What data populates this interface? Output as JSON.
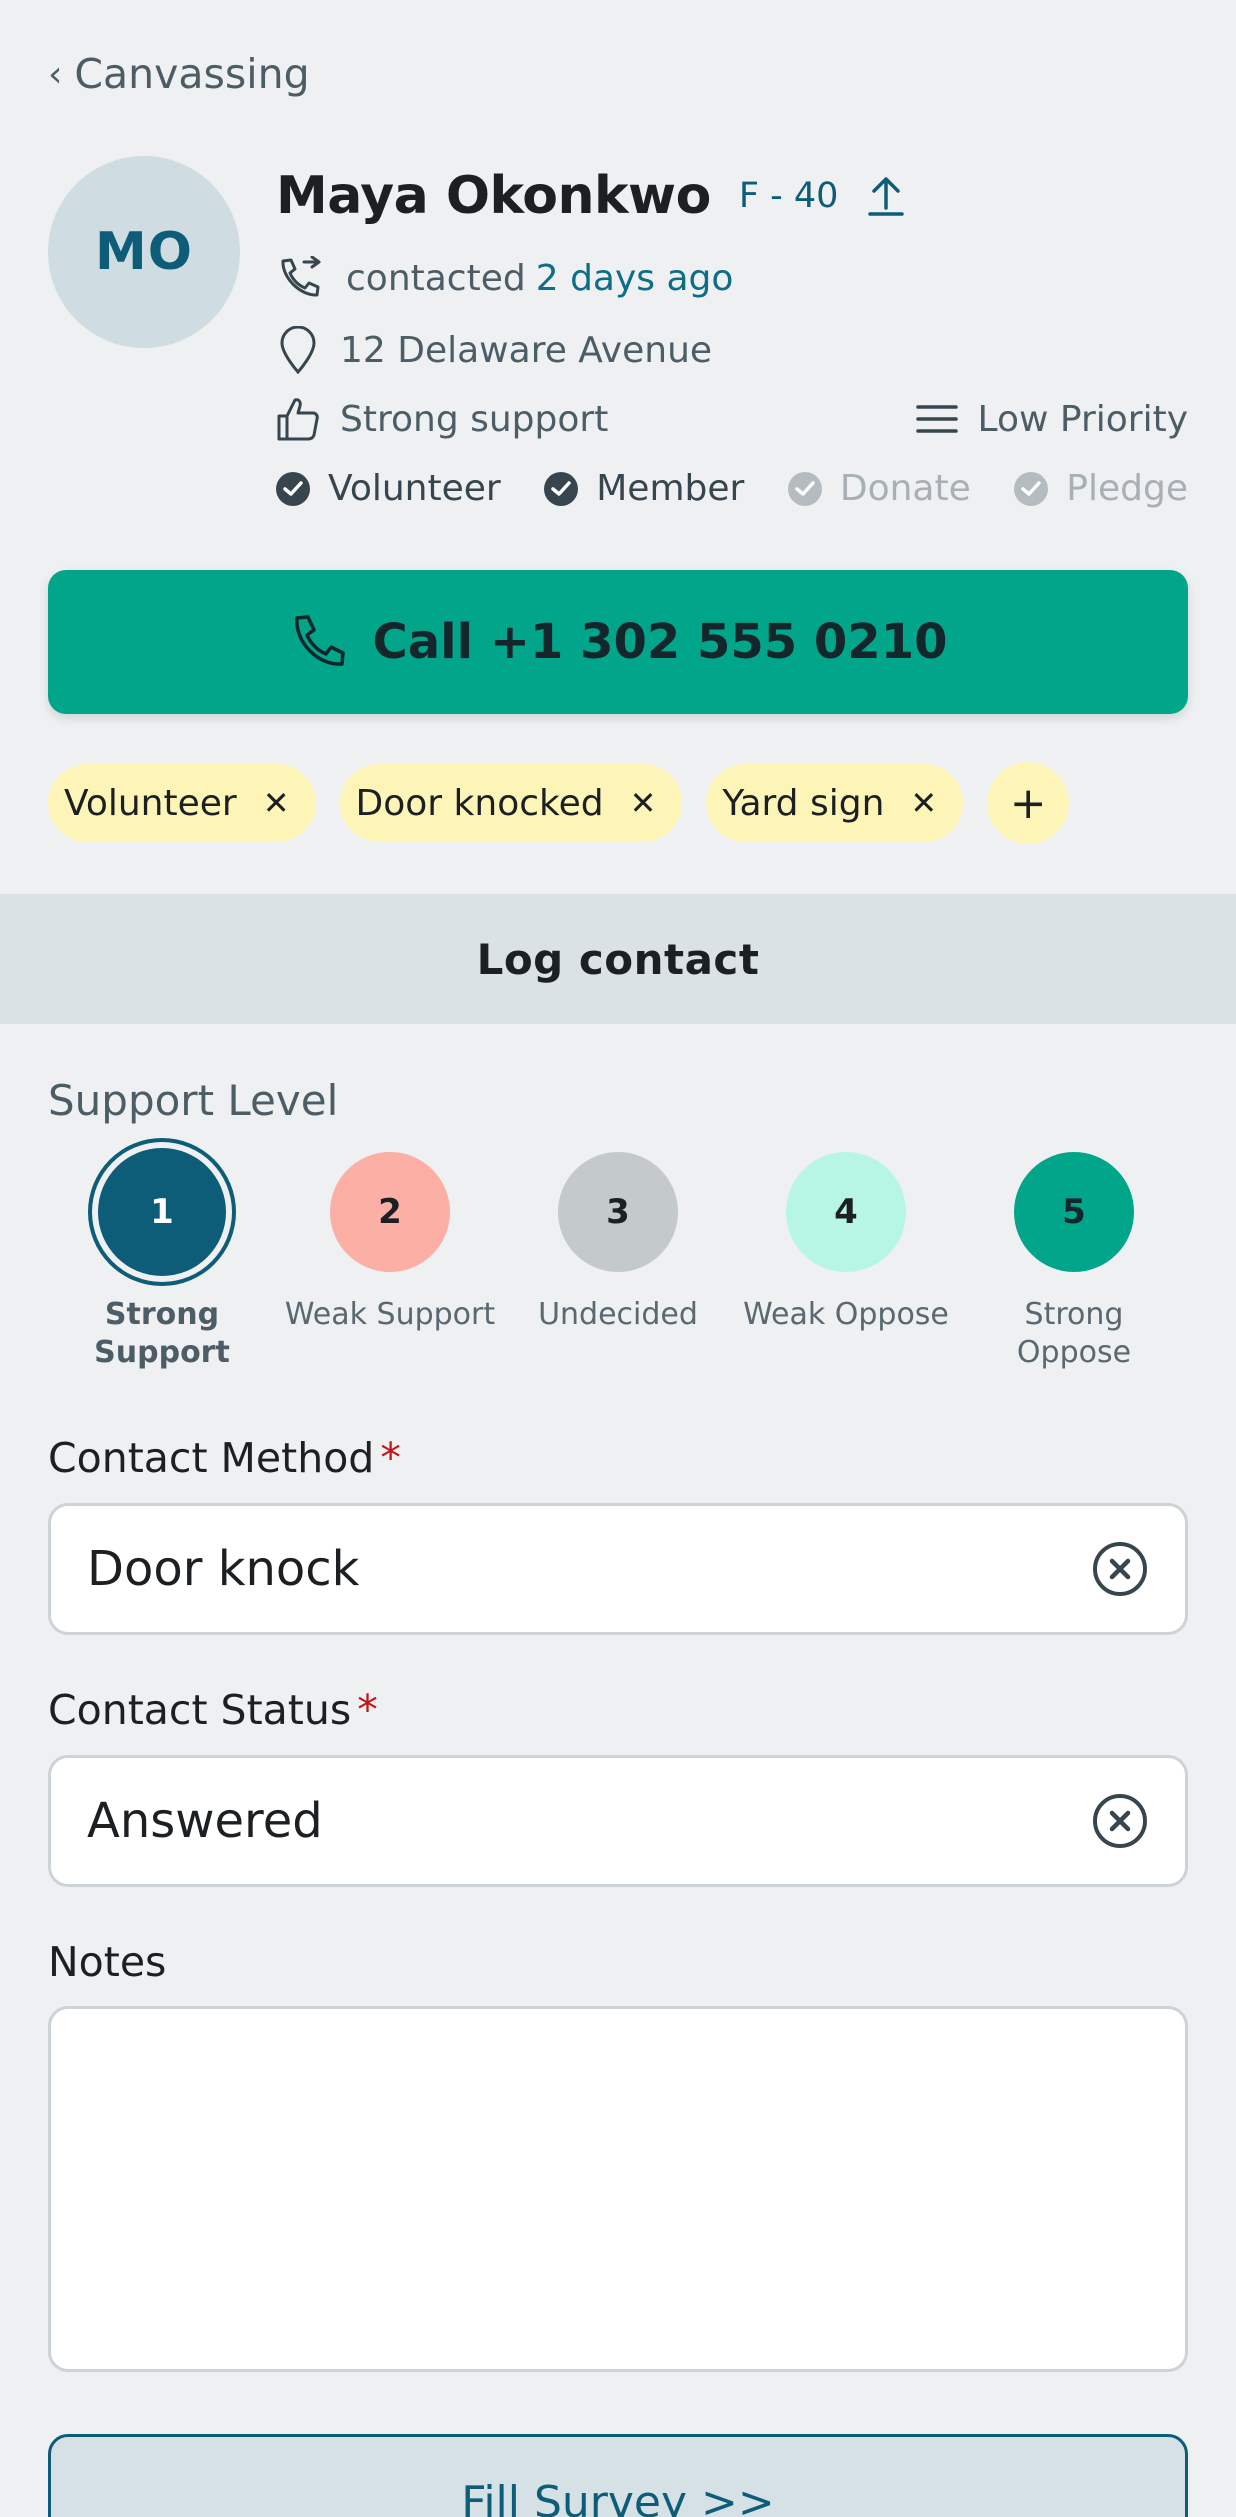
{
  "nav": {
    "back_label": "Canvassing"
  },
  "contact": {
    "initials": "MO",
    "name": "Maya Okonkwo",
    "gender_age": "F - 40",
    "contacted_prefix": "contacted",
    "contacted_when": "2 days ago",
    "address": "12 Delaware Avenue",
    "support": "Strong support",
    "priority": "Low Priority",
    "flags": [
      {
        "label": "Volunteer",
        "checked": true
      },
      {
        "label": "Member",
        "checked": true
      },
      {
        "label": "Donate",
        "checked": false
      },
      {
        "label": "Pledge",
        "checked": false
      }
    ]
  },
  "call_button": {
    "label": "Call +1 302 555 0210"
  },
  "tags": [
    "Volunteer",
    "Door knocked",
    "Yard sign"
  ],
  "tag_add_label": "+",
  "log_contact": {
    "title": "Log contact",
    "support_level_label": "Support Level",
    "levels": [
      {
        "num": "1",
        "label": "Strong Support",
        "selected": true,
        "color": "#0d5d78"
      },
      {
        "num": "2",
        "label": "Weak Support",
        "selected": false,
        "color": "#fbafa5"
      },
      {
        "num": "3",
        "label": "Undecided",
        "selected": false,
        "color": "#c4c9cc"
      },
      {
        "num": "4",
        "label": "Weak Oppose",
        "selected": false,
        "color": "#b7f6e4"
      },
      {
        "num": "5",
        "label": "Strong Oppose",
        "selected": false,
        "color": "#00a58a"
      }
    ],
    "contact_method_label": "Contact Method",
    "contact_method_value": "Door knock",
    "contact_status_label": "Contact Status",
    "contact_status_value": "Answered",
    "required_mark": "*",
    "notes_label": "Notes",
    "notes_value": ""
  },
  "survey_button": {
    "label": "Fill Survey >>"
  },
  "colors": {
    "primary": "#0d5d78",
    "call": "#00a58a",
    "tag": "#fdf5b8",
    "required": "#c01818"
  }
}
